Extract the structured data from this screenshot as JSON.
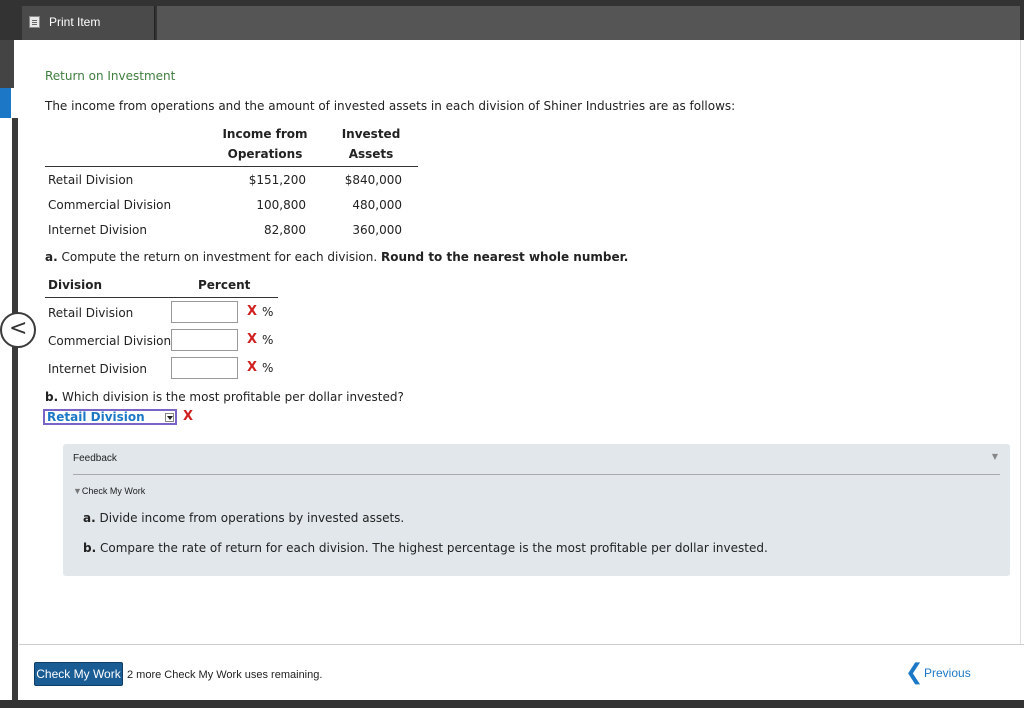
{
  "topbar": {
    "print_label": "Print Item",
    "print_icon": "print-icon"
  },
  "page": {
    "title": "Return on Investment",
    "intro": "The income from operations and the amount of invested assets in each division of Shiner Industries are as follows:"
  },
  "table": {
    "headers": {
      "income_line1": "Income from",
      "income_line2": "Operations",
      "assets_line1": "Invested",
      "assets_line2": "Assets"
    },
    "rows": [
      {
        "division": "Retail Division",
        "income": "$151,200",
        "assets": "$840,000"
      },
      {
        "division": "Commercial Division",
        "income": "100,800",
        "assets": "480,000"
      },
      {
        "division": "Internet Division",
        "income": "82,800",
        "assets": "360,000"
      }
    ]
  },
  "part_a": {
    "prefix": "a.",
    "question": " Compute the return on investment for each division. ",
    "bold_instruction": "Round to the nearest whole number.",
    "col_division": "Division",
    "col_percent": "Percent",
    "rows": [
      {
        "division": "Retail Division",
        "value": "",
        "mark": "X",
        "unit": "%"
      },
      {
        "division": "Commercial Division",
        "value": "",
        "mark": "X",
        "unit": "%"
      },
      {
        "division": "Internet Division",
        "value": "",
        "mark": "X",
        "unit": "%"
      }
    ]
  },
  "part_b": {
    "prefix": "b.",
    "question": " Which division is the most profitable per dollar invested?",
    "selected": "Retail Division",
    "mark": "X"
  },
  "feedback": {
    "label": "Feedback",
    "check_label": "Check My Work",
    "a_prefix": "a.",
    "a_text": " Divide income from operations by invested assets.",
    "b_prefix": "b.",
    "b_text": " Compare the rate of return for each division. The highest percentage is the most profitable per dollar invested."
  },
  "footer": {
    "check_button": "Check My Work",
    "remaining": "2 more Check My Work uses remaining.",
    "previous": "Previous"
  },
  "colors": {
    "accent_blue": "#1c78c6",
    "button_blue": "#1a5c94",
    "error_red": "#d02020",
    "title_green": "#3f7d3f",
    "feedback_bg": "#e1e7eb"
  }
}
